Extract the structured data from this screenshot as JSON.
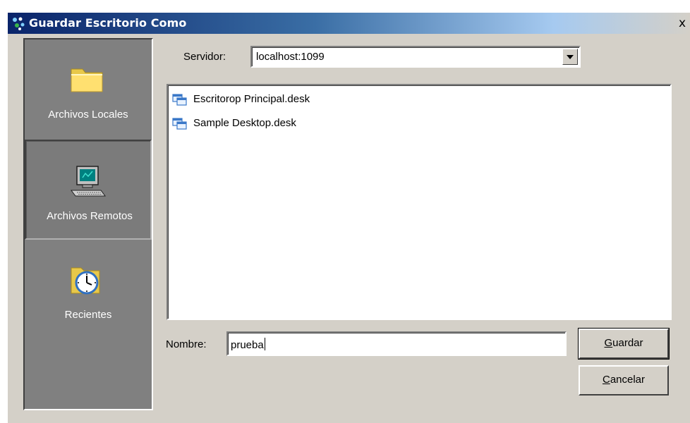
{
  "window": {
    "title": "Guardar Escritorio Como",
    "close_label": "x"
  },
  "sidebar": {
    "items": [
      {
        "label": "Archivos Locales",
        "icon": "folder-icon",
        "selected": false
      },
      {
        "label": "Archivos Remotos",
        "icon": "computer-icon",
        "selected": true
      },
      {
        "label": "Recientes",
        "icon": "clock-icon",
        "selected": false
      }
    ]
  },
  "server": {
    "label": "Servidor:",
    "value": "localhost:1099"
  },
  "files": [
    {
      "name": "Escritorop Principal.desk",
      "icon": "desktop-file-icon"
    },
    {
      "name": "Sample Desktop.desk",
      "icon": "desktop-file-icon"
    }
  ],
  "filename": {
    "label": "Nombre:",
    "value": "prueba"
  },
  "buttons": {
    "save_mnemonic": "G",
    "save_rest": "uardar",
    "cancel_mnemonic": "C",
    "cancel_rest": "ancelar"
  },
  "colors": {
    "titlebar_start": "#0a246a",
    "titlebar_end": "#a6caf0",
    "dialog_bg": "#d4d0c8",
    "sidebar_bg": "#808080"
  }
}
